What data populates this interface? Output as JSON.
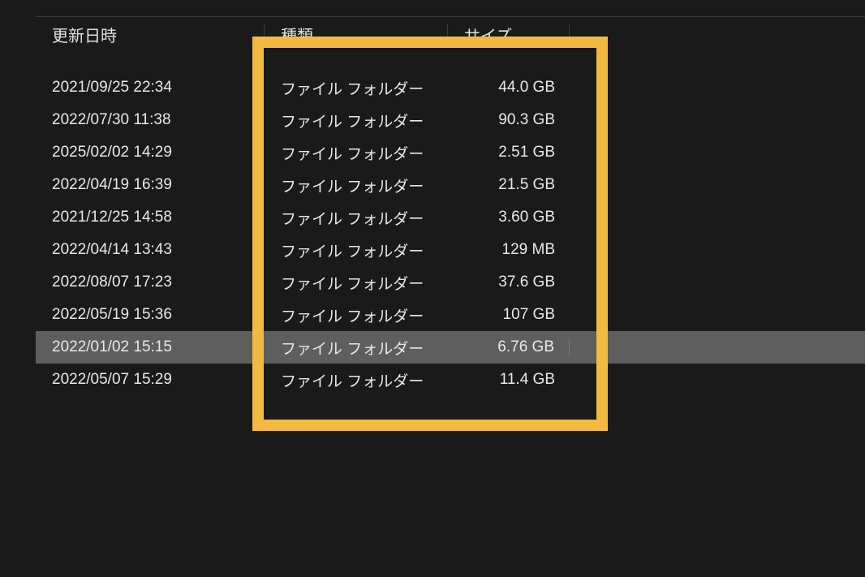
{
  "headers": {
    "date": "更新日時",
    "type": "種類",
    "size": "サイズ"
  },
  "rows": [
    {
      "date": "2021/09/25 22:34",
      "type": "ファイル フォルダー",
      "size": "44.0 GB",
      "selected": false
    },
    {
      "date": "2022/07/30 11:38",
      "type": "ファイル フォルダー",
      "size": "90.3 GB",
      "selected": false
    },
    {
      "date": "2025/02/02 14:29",
      "type": "ファイル フォルダー",
      "size": "2.51 GB",
      "selected": false
    },
    {
      "date": "2022/04/19 16:39",
      "type": "ファイル フォルダー",
      "size": "21.5 GB",
      "selected": false
    },
    {
      "date": "2021/12/25 14:58",
      "type": "ファイル フォルダー",
      "size": "3.60 GB",
      "selected": false
    },
    {
      "date": "2022/04/14 13:43",
      "type": "ファイル フォルダー",
      "size": "129 MB",
      "selected": false
    },
    {
      "date": "2022/08/07 17:23",
      "type": "ファイル フォルダー",
      "size": "37.6 GB",
      "selected": false
    },
    {
      "date": "2022/05/19 15:36",
      "type": "ファイル フォルダー",
      "size": "107 GB",
      "selected": false
    },
    {
      "date": "2022/01/02 15:15",
      "type": "ファイル フォルダー",
      "size": "6.76 GB",
      "selected": true
    },
    {
      "date": "2022/05/07 15:29",
      "type": "ファイル フォルダー",
      "size": "11.4 GB",
      "selected": false
    }
  ],
  "highlight_color": "#f2bb3f"
}
